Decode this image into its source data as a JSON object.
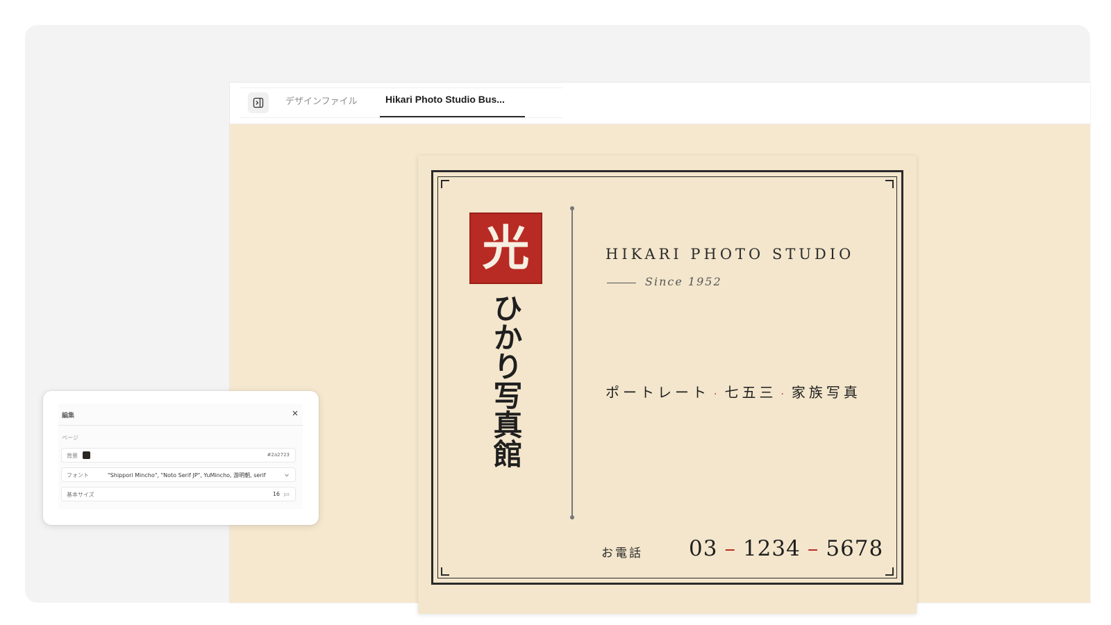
{
  "tabs": {
    "design_file": "デザインファイル",
    "active": "Hikari Photo Studio Bus..."
  },
  "card": {
    "seal_char": "光",
    "vertical_name": "ひかり写真館",
    "studio_name": "HIKARI PHOTO STUDIO",
    "since": "Since 1952",
    "services": [
      "ポートレート",
      "七五三",
      "家族写真"
    ],
    "separator": "·",
    "tel_label": "お電話",
    "phone_parts": [
      "03",
      "1234",
      "5678"
    ],
    "phone_dash": "–"
  },
  "editor": {
    "title": "編集",
    "section": "ページ",
    "bg_label": "背景",
    "bg_color": "#2a2723",
    "font_label": "フォント",
    "font_value": "\"Shippori Mincho\", \"Noto Serif JP\", YuMincho, 游明朝, serif",
    "size_label": "基本サイズ",
    "size_value": "16",
    "size_unit": "px"
  },
  "colors": {
    "accent_red": "#b82b24",
    "canvas": "#f6e8cf",
    "card": "#f3e6cc",
    "ink": "#2a2a2a"
  },
  "icons": {
    "sidebar_toggle": "sidebar-toggle-icon",
    "close": "close-icon",
    "chevron": "chevron-down-icon"
  }
}
